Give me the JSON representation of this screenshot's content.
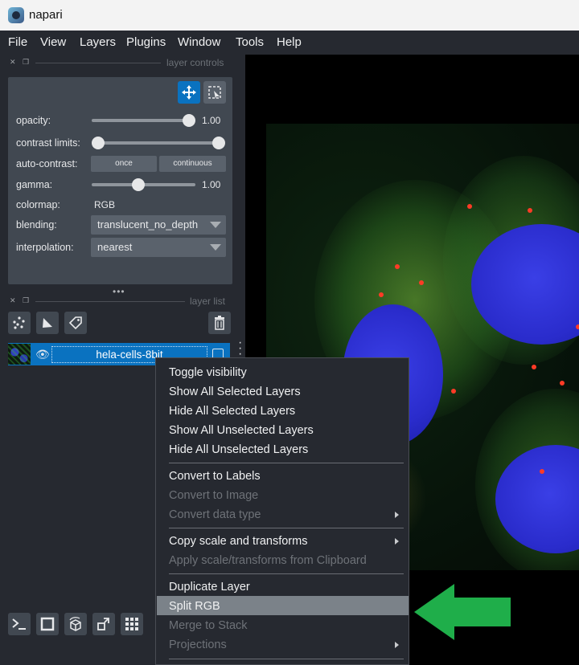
{
  "window": {
    "title": "napari"
  },
  "menubar": [
    "File",
    "View",
    "Layers",
    "Plugins",
    "Window",
    "Tools",
    "Help"
  ],
  "layer_controls": {
    "section_title": "layer controls",
    "opacity": {
      "label": "opacity:",
      "value": "1.00",
      "level": 1.0
    },
    "contrast_limits": {
      "label": "contrast limits:",
      "low": 0.0,
      "high": 1.0
    },
    "auto_contrast": {
      "label": "auto-contrast:",
      "once": "once",
      "continuous": "continuous"
    },
    "gamma": {
      "label": "gamma:",
      "value": "1.00",
      "level": 0.45
    },
    "colormap": {
      "label": "colormap:",
      "value": "RGB"
    },
    "blending": {
      "label": "blending:",
      "value": "translucent_no_depth"
    },
    "interpolation": {
      "label": "interpolation:",
      "value": "nearest"
    }
  },
  "layer_list": {
    "section_title": "layer list",
    "layers": [
      {
        "name": "hela-cells-8bit",
        "visible": true,
        "selected": true
      }
    ]
  },
  "context_menu": {
    "highlighted": "Split RGB",
    "items": [
      {
        "label": "Toggle visibility",
        "enabled": true
      },
      {
        "label": "Show All Selected Layers",
        "enabled": true
      },
      {
        "label": "Hide All Selected Layers",
        "enabled": true
      },
      {
        "label": "Show All Unselected Layers",
        "enabled": true
      },
      {
        "label": "Hide All Unselected Layers",
        "enabled": true
      },
      {
        "label": "Convert to Labels",
        "enabled": true
      },
      {
        "label": "Convert to Image",
        "enabled": false
      },
      {
        "label": "Convert data type",
        "enabled": false,
        "submenu": true
      },
      {
        "label": "Copy scale and transforms",
        "enabled": true,
        "submenu": true
      },
      {
        "label": "Apply scale/transforms from Clipboard",
        "enabled": false
      },
      {
        "label": "Duplicate Layer",
        "enabled": true
      },
      {
        "label": "Split RGB",
        "enabled": true
      },
      {
        "label": "Merge to Stack",
        "enabled": false
      },
      {
        "label": "Projections",
        "enabled": false,
        "submenu": true
      }
    ]
  },
  "colors": {
    "accent": "#0a72c0",
    "arrow": "#1fae4a",
    "panel": "#414851",
    "background": "#262930"
  }
}
